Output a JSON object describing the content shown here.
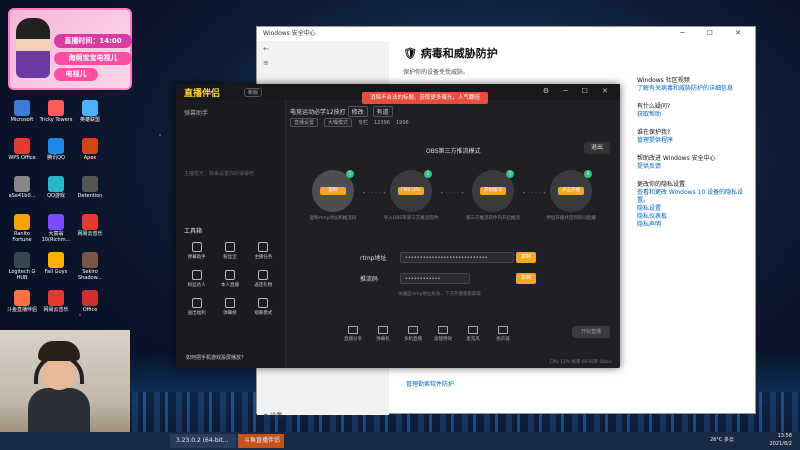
{
  "desktop": {
    "icons": [
      {
        "label": "Microsoft"
      },
      {
        "label": "Tricky Towers"
      },
      {
        "label": "英雄联盟"
      },
      {
        "label": "WPS Office"
      },
      {
        "label": "腾讯QQ"
      },
      {
        "label": "Apex"
      },
      {
        "label": "aSe41b0..."
      },
      {
        "label": "QQ游戏"
      },
      {
        "label": "Detention"
      },
      {
        "label": "Ranito Fortune"
      },
      {
        "label": "大富翁10(Richm..."
      },
      {
        "label": "网易云音乐"
      },
      {
        "label": "Logitech G HUB"
      },
      {
        "label": "Fall Guys"
      },
      {
        "label": "Sekiro Shadow..."
      },
      {
        "label": "斗鱼直播伴侣"
      },
      {
        "label": "网易云音乐"
      },
      {
        "label": "Office"
      }
    ]
  },
  "overlay": {
    "time_label": "直播时间：14:00",
    "tag1": "海绵宝宝电视儿",
    "tag2": "电视儿"
  },
  "security_window": {
    "title": "Windows 安全中心",
    "heading": "病毒和威胁防护",
    "subtitle": "保护你的设备免受威胁。",
    "right_blocks": [
      {
        "heading": "Windows 社区视频",
        "links": [
          "了解有关病毒和威胁防护的详细信息"
        ]
      },
      {
        "heading": "有什么疑问?",
        "links": [
          "获取帮助"
        ]
      },
      {
        "heading": "谁在保护我?",
        "links": [
          "管理提供程序"
        ]
      },
      {
        "heading": "帮助改进 Windows 安全中心",
        "links": [
          "提供反馈"
        ]
      },
      {
        "heading": "更改你的隐私设置",
        "links": [
          "查看和更改 Windows 10 设备的隐私设置。",
          "隐私设置",
          "隐私仪表板",
          "隐私声明"
        ]
      }
    ],
    "bottom_link": "管理勒索软件防护",
    "settings_label": "设置"
  },
  "live_app": {
    "brand": "直播伴侣",
    "version": "新版",
    "promo": "消除不合法的标题、获取更多曝光，人气翻倍",
    "left_header": "弹幕助手",
    "left_empty": "主播暂无，快来设置你的弹幕吧",
    "tools_title": "工具箱",
    "tools": [
      "弹幕助手",
      "粉丝宝",
      "主播任务",
      "粉丝达人",
      "本人直播",
      "返还礼物",
      "送出福利",
      "弹幕姬",
      "观看模式"
    ],
    "ask": "如何把手机游戏投屏播放?",
    "room_title": "电竞运动必学12技打",
    "room_tag1": "修改",
    "room_tag2": "有道",
    "room_meta": [
      "直播设置",
      "大嗓模式",
      "专栏",
      "12396",
      "1996"
    ],
    "obs_title": "OBS第三方推流模式",
    "exit": "退出",
    "steps": [
      {
        "num": "1",
        "text": "复制rtmp地址和推流码",
        "btn": "复制"
      },
      {
        "num": "2",
        "text": "导入OBS等第三方推流软件",
        "btn": "FMS URL"
      },
      {
        "num": "3",
        "text": "第三方推流软件内开启推流",
        "btn": "开始推流"
      },
      {
        "num": "4",
        "text": "伴侣开播并回到房间直播",
        "btn": "点击开播"
      }
    ],
    "rtmp_label": "rtmp地址",
    "rtmp_value": "••••••••••••••••••••••••••••",
    "key_label": "推流码",
    "key_value": "••••••••••••",
    "copy": "复制",
    "tip": "关播后rtmp地址失效，下次开播重新获取",
    "bottom_tools": [
      "直播分享",
      "弹幕机",
      "多机直播",
      "滤镜特效",
      "麦克风",
      "扬声器"
    ],
    "start_button": "开始直播",
    "status": "CPU 12%  帧率 60  码率 0Kb/s"
  },
  "taskbar": {
    "items": [
      "3.23.0.2 (64-bit...",
      "斗鱼直播伴侣"
    ],
    "weather": "26°C 多云",
    "time": "13:58",
    "date": "2021/8/2"
  }
}
